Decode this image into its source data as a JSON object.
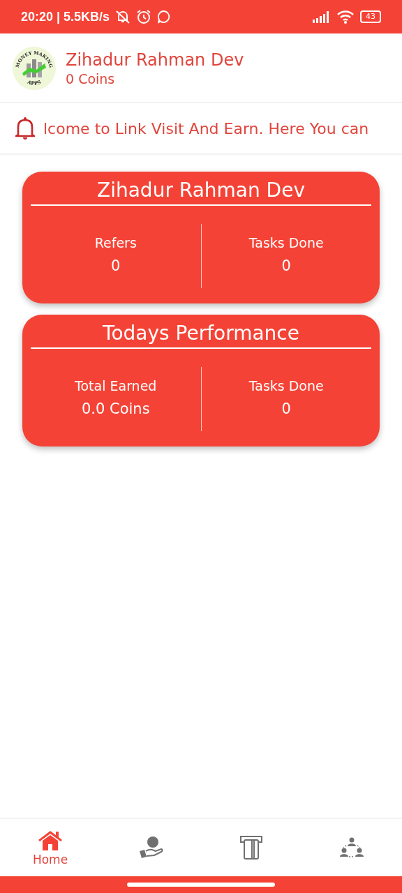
{
  "status_bar": {
    "time_speed": "20:20 | 5.5KB/s",
    "battery": "43"
  },
  "header": {
    "logo_text_top": "MONEY MAKING",
    "logo_text_bottom": "APPS",
    "name": "Zihadur Rahman Dev",
    "coins": "0 Coins"
  },
  "notice": {
    "text": "lcome to Link Visit And Earn. Here You can"
  },
  "cards": [
    {
      "title": "Zihadur Rahman Dev",
      "stats": [
        {
          "label": "Refers",
          "value": "0"
        },
        {
          "label": "Tasks Done",
          "value": "0"
        }
      ]
    },
    {
      "title": "Todays Performance",
      "stats": [
        {
          "label": "Total Earned",
          "value": "0.0 Coins"
        },
        {
          "label": "Tasks Done",
          "value": "0"
        }
      ]
    }
  ],
  "bottom_nav": [
    {
      "kind": "home",
      "label": "Home",
      "selected": true
    },
    {
      "kind": "earn",
      "selected": false
    },
    {
      "kind": "withdraw",
      "selected": false
    },
    {
      "kind": "refer",
      "selected": false
    }
  ]
}
